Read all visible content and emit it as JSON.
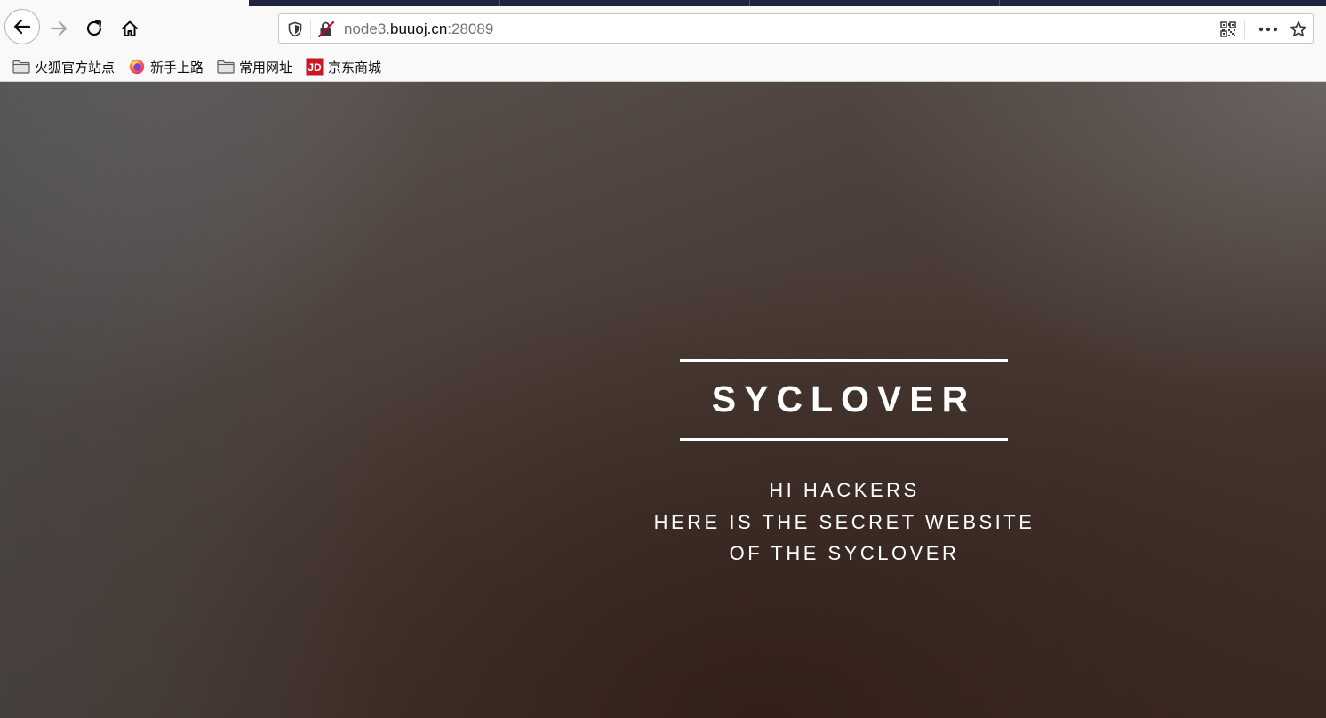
{
  "browser": {
    "url_prefix": "node3.",
    "url_domain": "buuoj.cn",
    "url_suffix": ":28089",
    "icons": {
      "back": "arrow-left-icon",
      "forward": "arrow-right-icon",
      "reload": "reload-icon",
      "home": "home-icon",
      "tracking": "shield-icon",
      "insecure": "insecure-lock-icon",
      "qr": "qr-code-icon",
      "menu": "more-dots-icon",
      "bookmark": "star-icon"
    }
  },
  "bookmarks": [
    {
      "label": "火狐官方站点",
      "icon": "folder-icon"
    },
    {
      "label": "新手上路",
      "icon": "firefox-icon"
    },
    {
      "label": "常用网址",
      "icon": "folder-icon"
    },
    {
      "label": "京东商城",
      "icon": "jd-icon"
    }
  ],
  "page": {
    "title": "SYCLOVER",
    "lines": [
      "HI HACKERS",
      "HERE IS THE SECRET WEBSITE",
      "OF THE SYCLOVER"
    ]
  },
  "colors": {
    "toolbar_bg": "#f9f9fa",
    "tab_strip": "#20223e",
    "insecure_red": "#d70022",
    "jd_red": "#c91623",
    "hero_text": "#ffffff"
  }
}
